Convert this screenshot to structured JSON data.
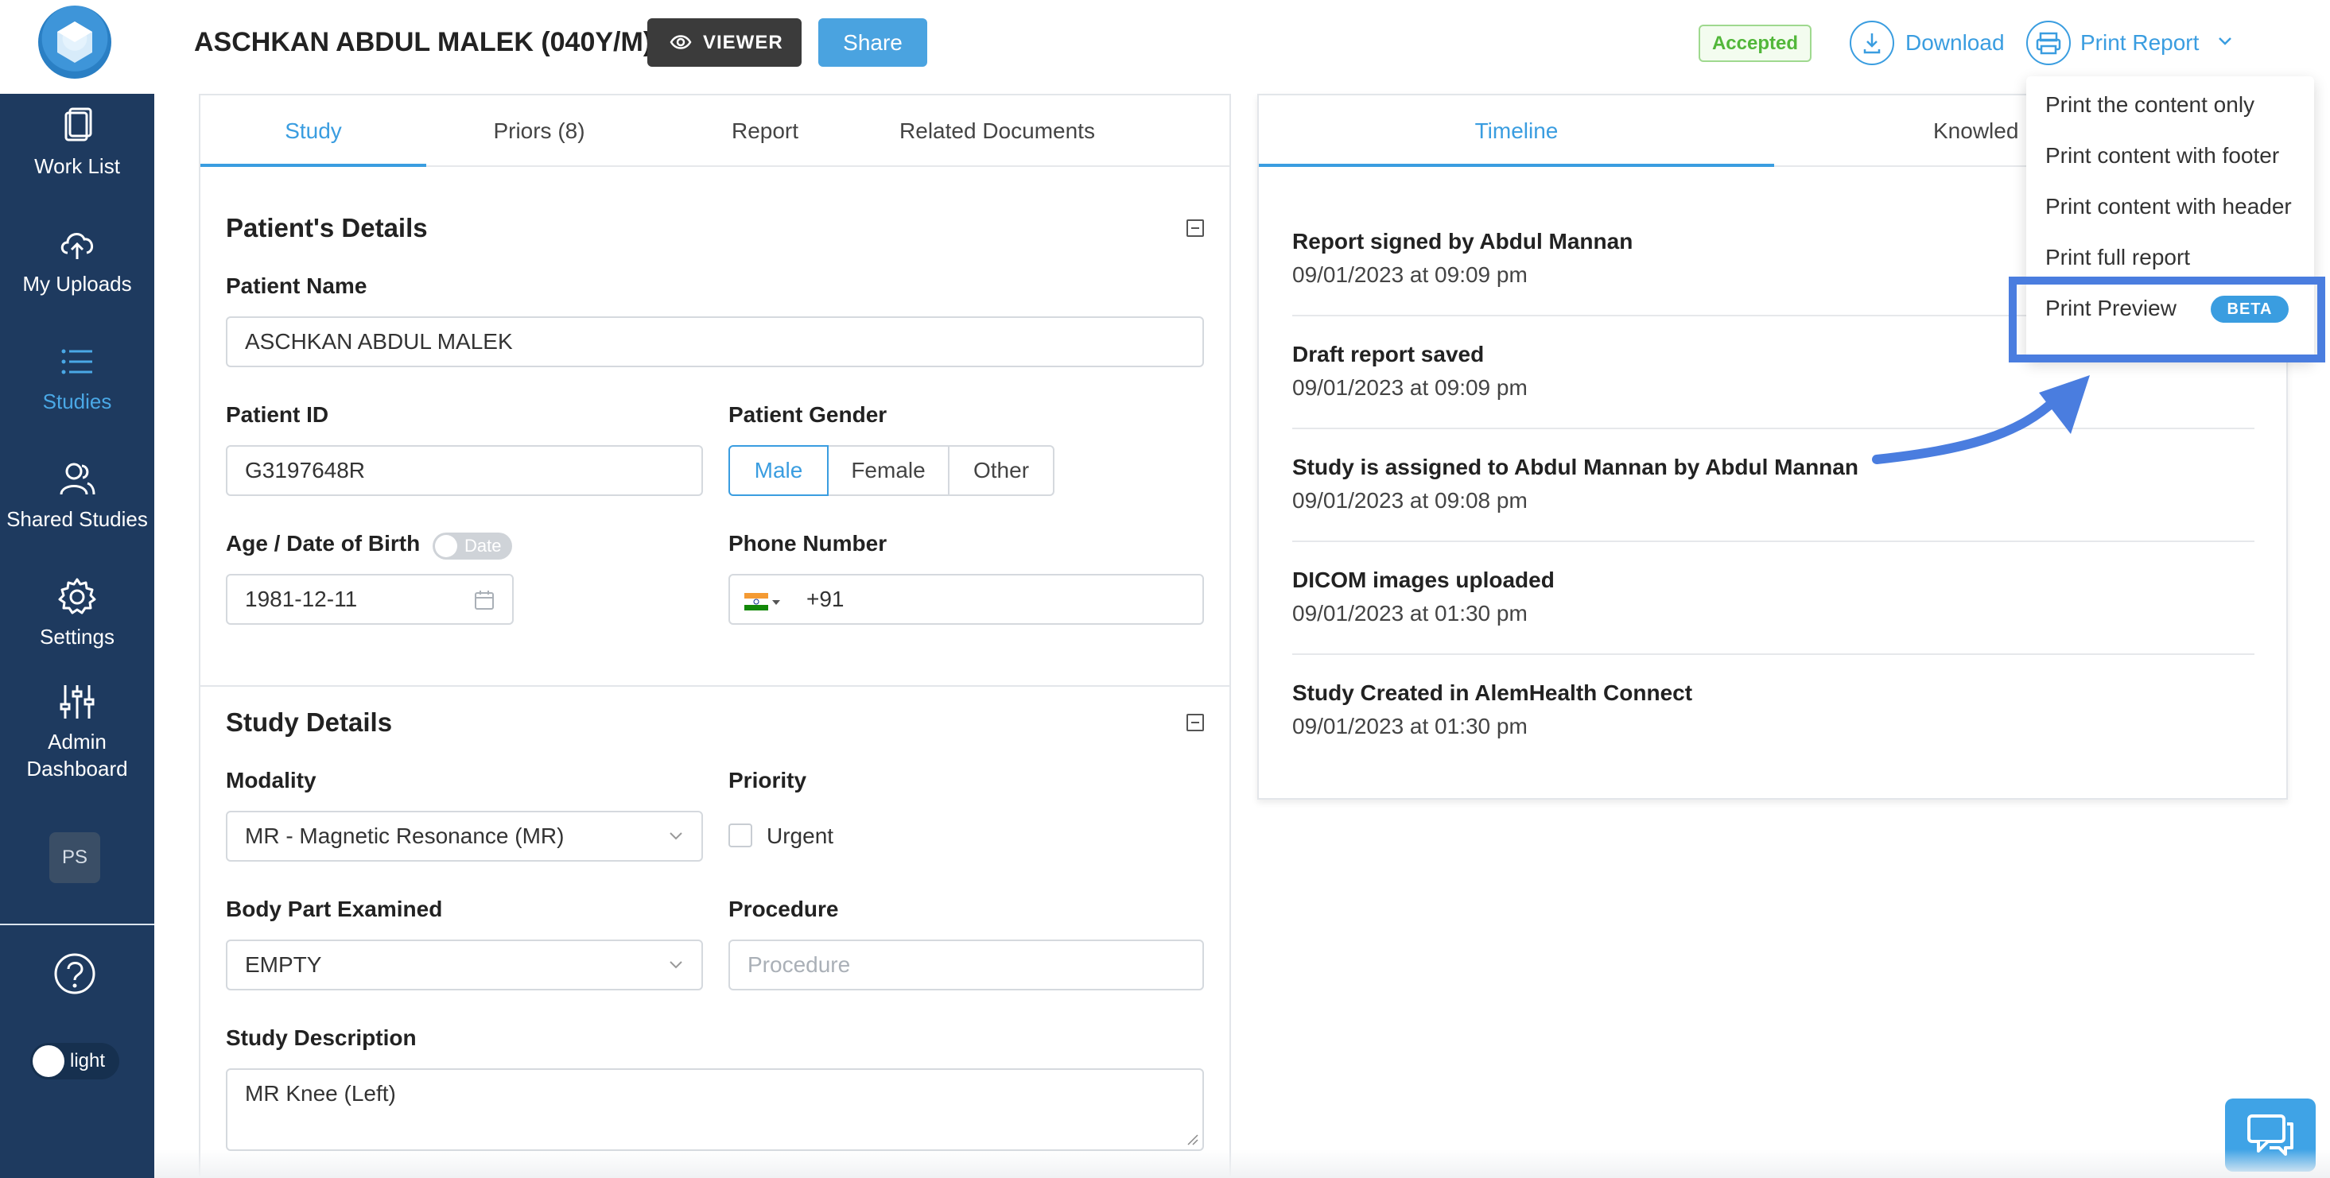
{
  "sidebar": {
    "items": [
      {
        "label": "Work List",
        "icon": "document-icon"
      },
      {
        "label": "My Uploads",
        "icon": "cloud-upload-icon"
      },
      {
        "label": "Studies",
        "icon": "list-icon"
      },
      {
        "label": "Shared Studies",
        "icon": "users-icon"
      },
      {
        "label": "Settings",
        "icon": "gear-icon"
      },
      {
        "label": "Admin Dashboard",
        "icon": "sliders-icon"
      }
    ],
    "active": "Studies",
    "avatar_initials": "PS",
    "theme_label": "light"
  },
  "header": {
    "title": "ASCHKAN ABDUL MALEK (040Y/M)",
    "viewer_label": "VIEWER",
    "share_label": "Share",
    "status_badge": "Accepted",
    "download_label": "Download",
    "print_label": "Print Report"
  },
  "left_tabs": [
    "Study",
    "Priors (8)",
    "Report",
    "Related Documents"
  ],
  "patient_details": {
    "title": "Patient's Details",
    "name_label": "Patient Name",
    "name_value": "ASCHKAN ABDUL MALEK",
    "id_label": "Patient ID",
    "id_value": "G3197648R",
    "gender_label": "Patient Gender",
    "gender_options": [
      "Male",
      "Female",
      "Other"
    ],
    "gender_selected": "Male",
    "age_label": "Age / Date of Birth",
    "date_toggle_label": "Date",
    "dob_value": "1981-12-11",
    "phone_label": "Phone Number",
    "phone_code": "+91"
  },
  "study_details": {
    "title": "Study Details",
    "modality_label": "Modality",
    "modality_value": "MR - Magnetic Resonance (MR)",
    "priority_label": "Priority",
    "urgent_label": "Urgent",
    "body_part_label": "Body Part Examined",
    "body_part_value": "EMPTY",
    "procedure_label": "Procedure",
    "procedure_placeholder": "Procedure",
    "description_label": "Study Description",
    "description_value": "MR Knee (Left)"
  },
  "right_tabs": [
    "Timeline",
    "Knowled"
  ],
  "timeline": [
    {
      "title": "Report signed by Abdul Mannan",
      "time": "09/01/2023 at 09:09 pm"
    },
    {
      "title": "Draft report saved",
      "time": "09/01/2023 at 09:09 pm"
    },
    {
      "title": "Study is assigned to Abdul Mannan by Abdul Mannan",
      "time": "09/01/2023 at 09:08 pm"
    },
    {
      "title": "DICOM images uploaded",
      "time": "09/01/2023 at 01:30 pm"
    },
    {
      "title": "Study Created in AlemHealth Connect",
      "time": "09/01/2023 at 01:30 pm"
    }
  ],
  "print_menu": {
    "items": [
      "Print the content only",
      "Print content with footer",
      "Print content with header",
      "Print full report",
      "Print Preview"
    ],
    "badge": "BETA"
  },
  "colors": {
    "sidebar_bg": "#1e3a5f",
    "accent": "#3a9de0",
    "highlight": "#4a7ddf",
    "status_green": "#52b73a"
  }
}
